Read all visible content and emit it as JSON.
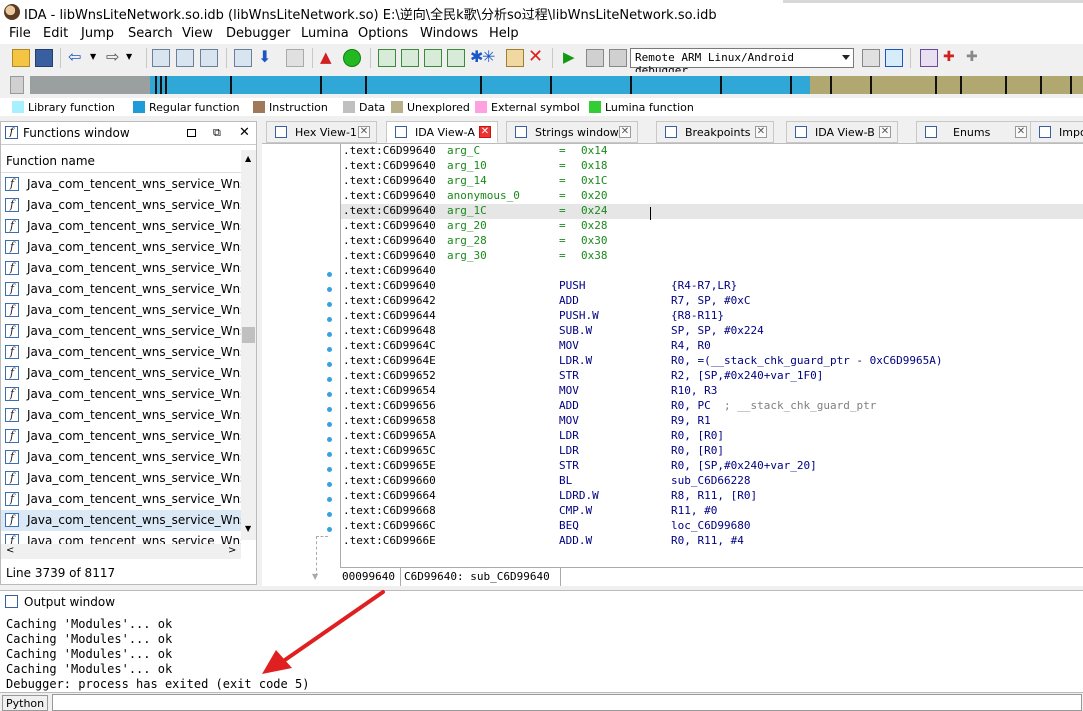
{
  "window": {
    "title": "IDA - libWnsLiteNetwork.so.idb (libWnsLiteNetwork.so) E:\\逆向\\全民k歌\\分析so过程\\libWnsLiteNetwork.so.idb"
  },
  "menu": [
    "File",
    "Edit",
    "Jump",
    "Search",
    "View",
    "Debugger",
    "Lumina",
    "Options",
    "Windows",
    "Help"
  ],
  "toolbar": {
    "debugger_selected": "Remote ARM Linux/Android debugger"
  },
  "legend": [
    {
      "label": "Library function",
      "color": "#a6f0ff"
    },
    {
      "label": "Regular function",
      "color": "#1e9cd8"
    },
    {
      "label": "Instruction",
      "color": "#a0785a"
    },
    {
      "label": "Data",
      "color": "#c0c0c0"
    },
    {
      "label": "Unexplored",
      "color": "#b8b08a"
    },
    {
      "label": "External symbol",
      "color": "#ffa0e0"
    },
    {
      "label": "Lumina function",
      "color": "#33cc33"
    }
  ],
  "functions_window": {
    "title": "Functions window",
    "column_header": "Function name",
    "items": [
      "Java_com_tencent_wns_service_WnsN",
      "Java_com_tencent_wns_service_WnsN",
      "Java_com_tencent_wns_service_WnsN",
      "Java_com_tencent_wns_service_WnsN",
      "Java_com_tencent_wns_service_WnsN",
      "Java_com_tencent_wns_service_WnsN",
      "Java_com_tencent_wns_service_WnsN",
      "Java_com_tencent_wns_service_WnsN",
      "Java_com_tencent_wns_service_WnsN",
      "Java_com_tencent_wns_service_WnsN",
      "Java_com_tencent_wns_service_WnsN",
      "Java_com_tencent_wns_service_WnsN",
      "Java_com_tencent_wns_service_WnsN",
      "Java_com_tencent_wns_service_WnsN",
      "Java_com_tencent_wns_service_WnsN",
      "Java_com_tencent_wns_service_WnsN",
      "Java_com_tencent_wns_service_WnsN",
      "Java_com_tencent_wns_service_WnsN"
    ],
    "selected_index": 16,
    "status": "Line 3739 of 8117"
  },
  "tabs": [
    {
      "label": "Hex View-1",
      "active": false
    },
    {
      "label": "IDA View-A",
      "active": true
    },
    {
      "label": "Strings window",
      "active": false
    },
    {
      "label": "Breakpoints",
      "active": false
    },
    {
      "label": "IDA View-B",
      "active": false
    },
    {
      "label": "Enums",
      "active": false
    },
    {
      "label": "Impo",
      "active": false
    }
  ],
  "disasm": {
    "vars": [
      {
        "addr": ".text:C6D99640",
        "name": "arg_C",
        "value": "0x14"
      },
      {
        "addr": ".text:C6D99640",
        "name": "arg_10",
        "value": "0x18"
      },
      {
        "addr": ".text:C6D99640",
        "name": "arg_14",
        "value": "0x1C"
      },
      {
        "addr": ".text:C6D99640",
        "name": "anonymous_0",
        "value": "0x20"
      },
      {
        "addr": ".text:C6D99640",
        "name": "arg_1C",
        "value": "0x24"
      },
      {
        "addr": ".text:C6D99640",
        "name": "arg_20",
        "value": "0x28"
      },
      {
        "addr": ".text:C6D99640",
        "name": "arg_28",
        "value": "0x30"
      },
      {
        "addr": ".text:C6D99640",
        "name": "arg_30",
        "value": "0x38"
      }
    ],
    "highlight_index": 4,
    "blank_addr": ".text:C6D99640",
    "code": [
      {
        "addr": ".text:C6D99640",
        "mn": "PUSH",
        "op": "{R4-R7,LR}",
        "cm": ""
      },
      {
        "addr": ".text:C6D99642",
        "mn": "ADD",
        "op": "R7, SP, #0xC",
        "cm": ""
      },
      {
        "addr": ".text:C6D99644",
        "mn": "PUSH.W",
        "op": "{R8-R11}",
        "cm": ""
      },
      {
        "addr": ".text:C6D99648",
        "mn": "SUB.W",
        "op": "SP, SP, #0x224",
        "cm": ""
      },
      {
        "addr": ".text:C6D9964C",
        "mn": "MOV",
        "op": "R4, R0",
        "cm": ""
      },
      {
        "addr": ".text:C6D9964E",
        "mn": "LDR.W",
        "op": "R0, =(__stack_chk_guard_ptr - 0xC6D9965A)",
        "cm": ""
      },
      {
        "addr": ".text:C6D99652",
        "mn": "STR",
        "op": "R2, [SP,#0x240+var_1F0]",
        "cm": ""
      },
      {
        "addr": ".text:C6D99654",
        "mn": "MOV",
        "op": "R10, R3",
        "cm": ""
      },
      {
        "addr": ".text:C6D99656",
        "mn": "ADD",
        "op": "R0, PC",
        "cm": "  ; __stack_chk_guard_ptr"
      },
      {
        "addr": ".text:C6D99658",
        "mn": "MOV",
        "op": "R9, R1",
        "cm": ""
      },
      {
        "addr": ".text:C6D9965A",
        "mn": "LDR",
        "op": "R0, [R0]",
        "cm": ""
      },
      {
        "addr": ".text:C6D9965C",
        "mn": "LDR",
        "op": "R0, [R0]",
        "cm": ""
      },
      {
        "addr": ".text:C6D9965E",
        "mn": "STR",
        "op": "R0, [SP,#0x240+var_20]",
        "cm": ""
      },
      {
        "addr": ".text:C6D99660",
        "mn": "BL",
        "op": "sub_C6D66228",
        "cm": ""
      },
      {
        "addr": ".text:C6D99664",
        "mn": "LDRD.W",
        "op": "R8, R11, [R0]",
        "cm": ""
      },
      {
        "addr": ".text:C6D99668",
        "mn": "CMP.W",
        "op": "R11, #0",
        "cm": ""
      },
      {
        "addr": ".text:C6D9966C",
        "mn": "BEQ",
        "op": "loc_C6D99680",
        "cm": ""
      },
      {
        "addr": ".text:C6D9966E",
        "mn": "ADD.W",
        "op": "R0, R11, #4",
        "cm": ""
      }
    ],
    "status_offset": "00099640",
    "status_location": "C6D99640: sub_C6D99640"
  },
  "output": {
    "title": "Output window",
    "lines": [
      "Caching 'Modules'... ok",
      "Caching 'Modules'... ok",
      "Caching 'Modules'... ok",
      "Caching 'Modules'... ok",
      "Debugger: process has exited (exit code 5)"
    ],
    "python_button": "Python"
  }
}
